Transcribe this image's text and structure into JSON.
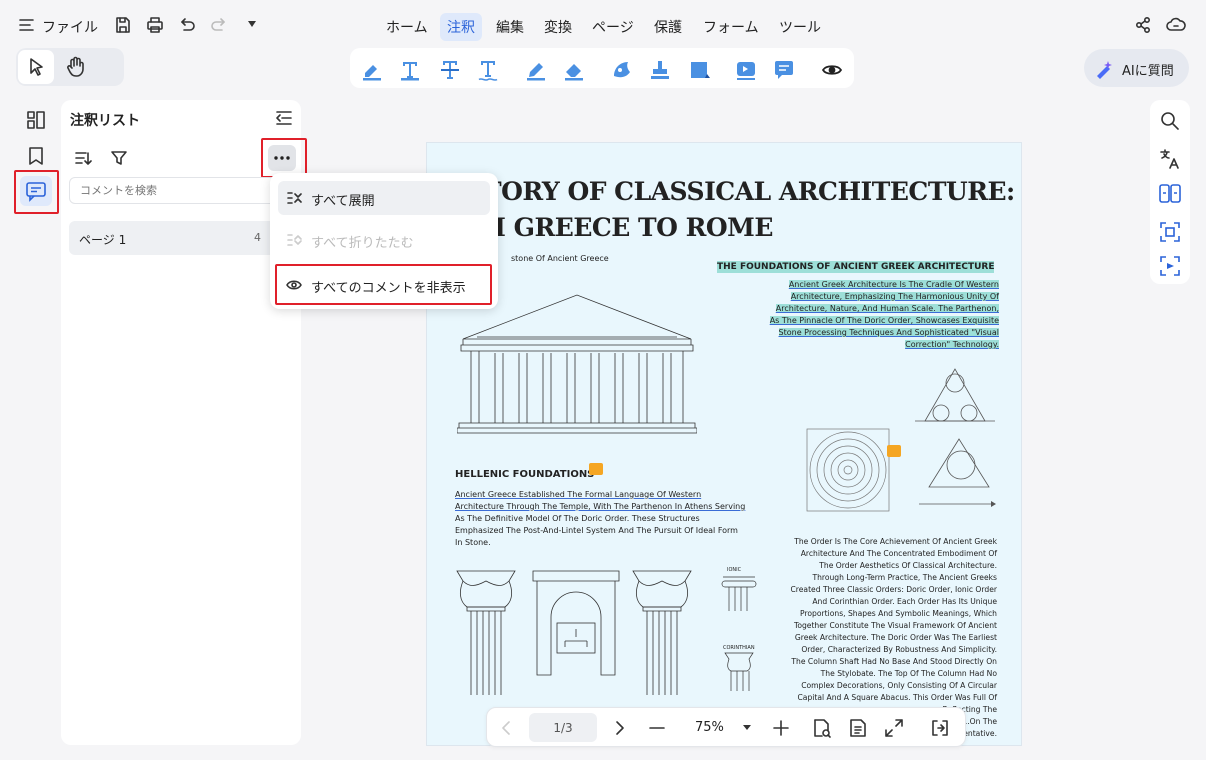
{
  "menubar": {
    "file_label": "ファイル",
    "tabs": [
      "ホーム",
      "注釈",
      "編集",
      "変換",
      "ページ",
      "保護",
      "フォーム",
      "ツール"
    ],
    "active_tab": "注釈"
  },
  "ai_button": {
    "label": "AIに質問"
  },
  "sidebar_panel": {
    "title": "注釈リスト",
    "search_placeholder": "コメントを検索",
    "page_group": {
      "label": "ページ 1",
      "count": "4"
    }
  },
  "more_menu": {
    "items": [
      {
        "label": "すべて展開",
        "enabled": true
      },
      {
        "label": "すべて折りたたむ",
        "enabled": false
      },
      {
        "label": "すべてのコメントを非表示",
        "enabled": true
      }
    ]
  },
  "document": {
    "title_line1": "TORY OF CLASSICAL  ARCHITECTURE:",
    "title_line2": "OM GREECE TO ROME",
    "caption_left": "stone Of Ancient Greece",
    "section1_heading": "THE FOUNDATIONS OF ANCIENT GREEK ARCHITECTURE",
    "section1_lines": [
      "Ancient Greek Architecture Is The Cradle Of Western",
      "Architecture, Emphasizing The Harmonious Unity Of",
      "Architecture, Nature, And Human Scale. The Parthenon,",
      "As The Pinnacle Of The Doric Order, Showcases Exquisite",
      "Stone Processing Techniques And Sophisticated \"Visual",
      "Correction\" Technology."
    ],
    "section2_heading": "HELLENIC FOUNDATIONS",
    "section2_lines": [
      "Ancient Greece Established The Formal Language Of Western",
      "Architecture Through The Temple, With The Parthenon In Athens Serving",
      "As The Definitive Model Of The Doric Order. These Structures",
      "Emphasized The Post-And-Lintel System And The Pursuit Of Ideal Form",
      "In Stone."
    ],
    "section3_lines": [
      "The Order Is The Core Achievement Of Ancient Greek",
      "Architecture And The Concentrated Embodiment Of",
      "The Order Aesthetics Of Classical Architecture.",
      "Through Long-Term Practice, The Ancient Greeks",
      "Created Three Classic Orders: Doric Order, Ionic Order",
      "And Corinthian Order. Each Order Has Its Unique",
      "Proportions, Shapes And Symbolic Meanings, Which",
      "Together Constitute The Visual Framework Of Ancient",
      "Greek Architecture. The Doric Order Was The Earliest",
      "Order, Characterized By Robustness And Simplicity.",
      "The Column Shaft Had No Base And Stood Directly On",
      "The Stylobate. The Top Of The Column Had No",
      "Complex Decorations, Only Consisting Of A Circular",
      "Capital And A Square Abacus. This Order Was Full Of",
      "...Reflecting The",
      "...On The",
      "...sentative."
    ],
    "label_ionic": "IONIC",
    "label_corinthian": "CORINTHIAN"
  },
  "bottom_bar": {
    "page": "1/3",
    "zoom": "75%"
  },
  "colors": {
    "accent": "#2b63d9",
    "highlight": "#9ddfd8",
    "comment_icon": "#f5a623",
    "red_box": "#e0202a"
  }
}
